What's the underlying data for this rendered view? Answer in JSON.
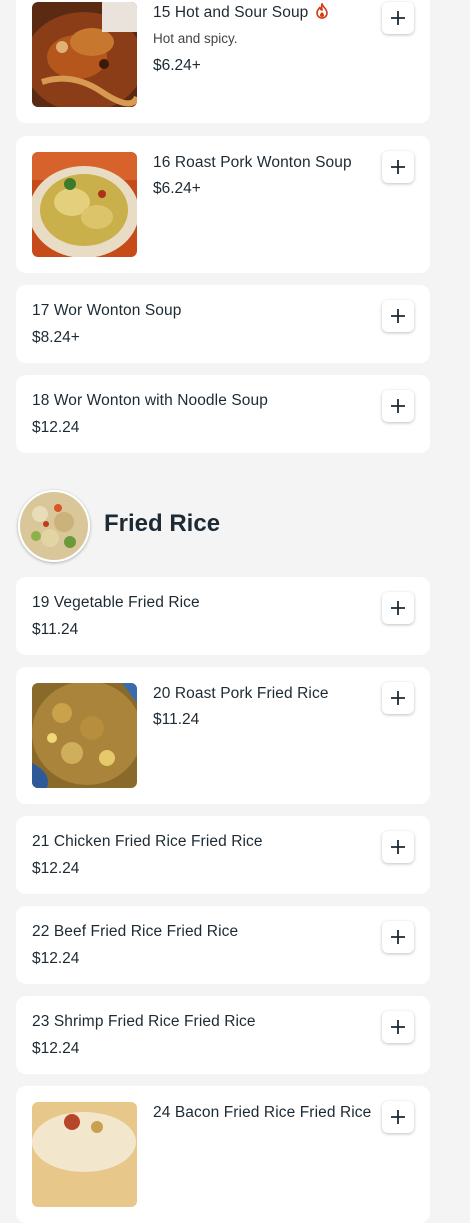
{
  "items": [
    {
      "name": "15 Hot and Sour Soup",
      "description": "Hot and spicy.",
      "price": "$6.24+"
    },
    {
      "name": "16 Roast Pork Wonton Soup",
      "price": "$6.24+"
    },
    {
      "name": "17 Wor Wonton Soup",
      "price": "$8.24+"
    },
    {
      "name": "18 Wor Wonton with Noodle Soup",
      "price": "$12.24"
    }
  ],
  "section": {
    "title": "Fried Rice"
  },
  "fried_rice_items": [
    {
      "name": "19 Vegetable Fried Rice",
      "price": "$11.24"
    },
    {
      "name": "20 Roast Pork Fried Rice",
      "price": "$11.24"
    },
    {
      "name": "21 Chicken Fried Rice Fried Rice",
      "price": "$12.24"
    },
    {
      "name": "22 Beef Fried Rice Fried Rice",
      "price": "$12.24"
    },
    {
      "name": "23 Shrimp Fried Rice Fried Rice",
      "price": "$12.24"
    },
    {
      "name": "24 Bacon Fried Rice Fried Rice"
    }
  ],
  "icons": {
    "add": "plus-icon",
    "spicy": "flame-icon"
  },
  "colors": {
    "background": "#f4f4f4",
    "card": "#ffffff",
    "text": "#1d2a33",
    "spicy": "#d63a12"
  }
}
